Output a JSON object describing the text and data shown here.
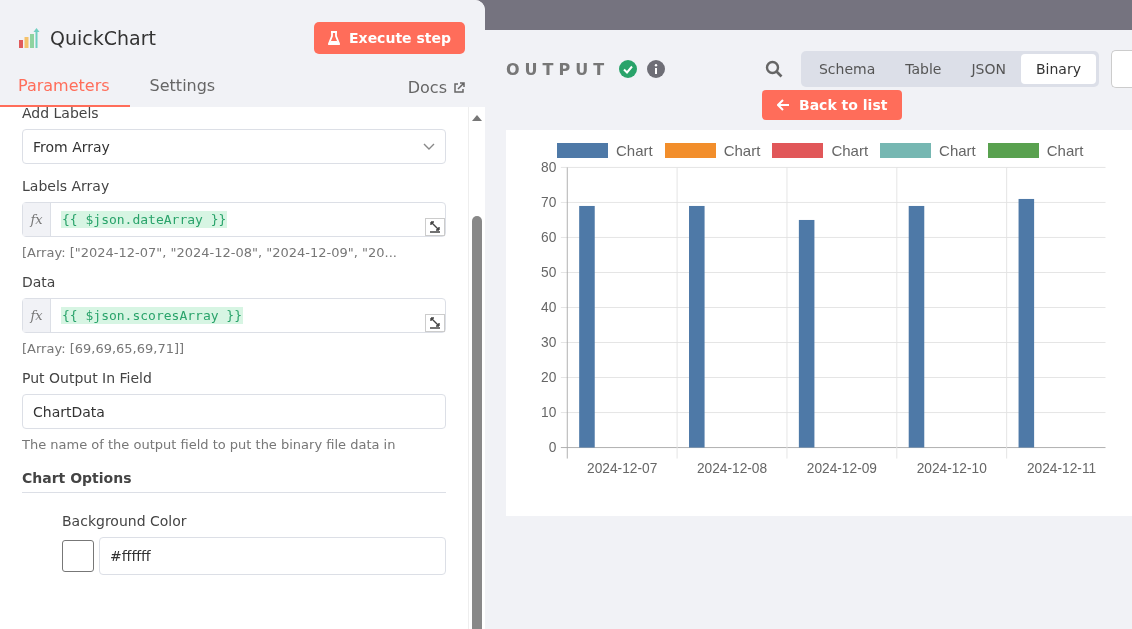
{
  "node": {
    "title": "QuickChart",
    "execute_button": "Execute step"
  },
  "tabs": [
    {
      "label": "Parameters",
      "selected": true
    },
    {
      "label": "Settings",
      "selected": false
    }
  ],
  "docs_link": "Docs",
  "params": [
    {
      "kind": "select",
      "label": "Add Labels",
      "value": "From Array"
    },
    {
      "kind": "expression",
      "label": "Labels Array",
      "prefix": "fx",
      "value": "{{ $json.dateArray }}",
      "hint": "[Array: [\"2024-12-07\", \"2024-12-08\", \"2024-12-09\", \"20..."
    },
    {
      "kind": "expression",
      "label": "Data",
      "prefix": "fx",
      "value": "{{ $json.scoresArray }}",
      "hint": "[Array: [69,69,65,69,71]]"
    },
    {
      "kind": "text",
      "label": "Put Output In Field",
      "value": "ChartData",
      "hint": "The name of the output field to put the binary file data in"
    },
    {
      "kind": "section",
      "label": "Chart Options"
    },
    {
      "kind": "color",
      "label": "Background Color",
      "value": "#ffffff"
    }
  ],
  "output": {
    "title": "OUTPUT",
    "views": [
      {
        "label": "Schema",
        "selected": false
      },
      {
        "label": "Table",
        "selected": false
      },
      {
        "label": "JSON",
        "selected": false
      },
      {
        "label": "Binary",
        "selected": true
      }
    ],
    "back_button": "Back to list",
    "chart_data": {
      "type": "bar",
      "grid": true,
      "categories": [
        "2024-12-07",
        "2024-12-08",
        "2024-12-09",
        "2024-12-10",
        "2024-12-11"
      ],
      "series": [
        {
          "name": "Chart",
          "color": "#4e79a7",
          "values": [
            69,
            69,
            65,
            69,
            71
          ]
        },
        {
          "name": "Chart",
          "color": "#f28e2b",
          "values": [
            null,
            null,
            null,
            null,
            null
          ]
        },
        {
          "name": "Chart",
          "color": "#e15759",
          "values": [
            null,
            null,
            null,
            null,
            null
          ]
        },
        {
          "name": "Chart",
          "color": "#76b7b2",
          "values": [
            null,
            null,
            null,
            null,
            null
          ]
        },
        {
          "name": "Chart",
          "color": "#59a14f",
          "values": [
            null,
            null,
            null,
            null,
            null
          ]
        }
      ],
      "ylim": [
        0,
        80
      ],
      "yticks": [
        0,
        10,
        20,
        30,
        40,
        50,
        60,
        70,
        80
      ]
    }
  }
}
